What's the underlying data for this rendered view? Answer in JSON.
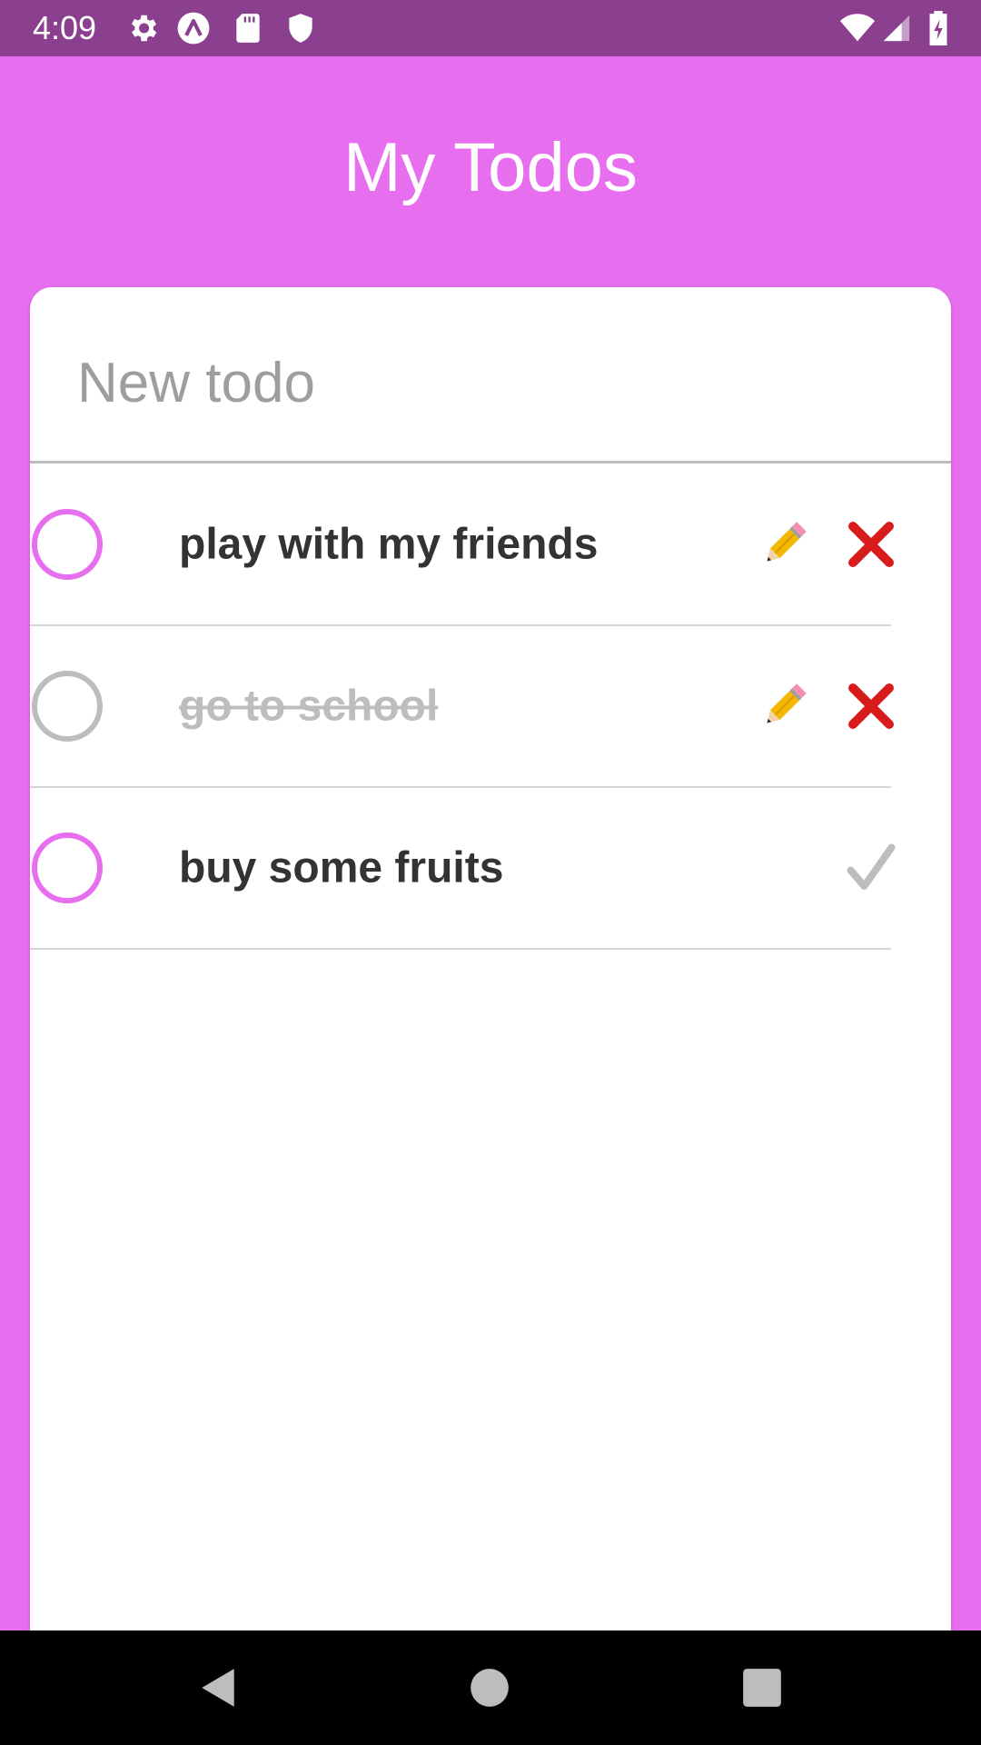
{
  "status_bar": {
    "time": "4:09",
    "left_icons": [
      "gear-icon",
      "app-a-icon",
      "sd-card-icon",
      "shield-icon"
    ],
    "right_icons": [
      "wifi-icon",
      "signal-icon",
      "battery-charging-icon"
    ]
  },
  "header": {
    "title": "My Todos"
  },
  "new_todo": {
    "placeholder": "New todo",
    "value": ""
  },
  "todos": [
    {
      "text": "play with my friends",
      "completed": false,
      "actions": [
        "pencil-icon",
        "close-x-icon"
      ]
    },
    {
      "text": "go to school",
      "completed": true,
      "actions": [
        "pencil-icon",
        "close-x-icon"
      ]
    },
    {
      "text": "buy some fruits",
      "completed": false,
      "actions": [
        "checkmark-icon"
      ]
    }
  ],
  "nav_bar": {
    "buttons": [
      "back-icon",
      "home-icon",
      "recents-icon"
    ]
  },
  "colors": {
    "accent": "#E86EF0",
    "status_bar": "#8B3F8F",
    "text": "#333333",
    "muted": "#BDBDBD",
    "delete": "#D81B1B",
    "pencil": "#F5B800"
  }
}
